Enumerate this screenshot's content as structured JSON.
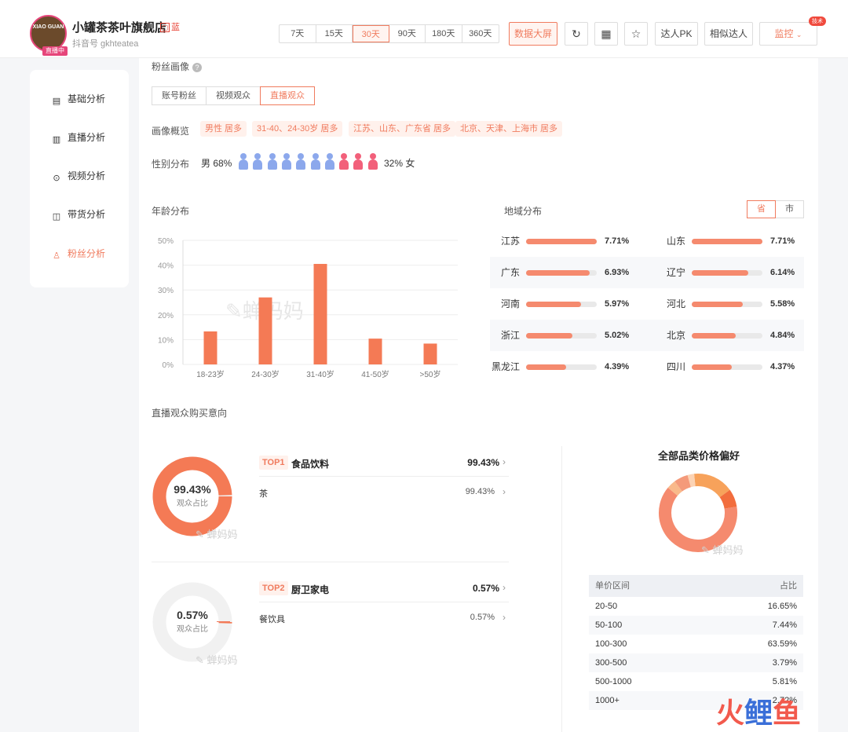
{
  "header": {
    "avatar_logo_text": "XIAO GUAN",
    "live_badge": "直播中",
    "shop_name": "小罐茶茶叶旗舰店",
    "shop_tag": "蓝",
    "shop_id": "抖音号 gkhteatea",
    "days": [
      "7天",
      "15天",
      "30天",
      "90天",
      "180天",
      "360天"
    ],
    "active_day": "30天",
    "big_screen": "数据大屏",
    "daren_pk": "达人PK",
    "similar": "相似达人",
    "monitor": "监控",
    "hot_badge": "技术"
  },
  "sidebar": {
    "items": [
      {
        "label": "基础分析",
        "icon": "bar-chart-icon"
      },
      {
        "label": "直播分析",
        "icon": "live-icon"
      },
      {
        "label": "视频分析",
        "icon": "play-icon"
      },
      {
        "label": "带货分析",
        "icon": "bag-icon"
      },
      {
        "label": "粉丝分析",
        "icon": "user-icon"
      }
    ],
    "active": "粉丝分析"
  },
  "fans": {
    "title": "粉丝画像",
    "tabs": [
      "账号粉丝",
      "视频观众",
      "直播观众"
    ],
    "active_tab": "直播观众",
    "overview_label": "画像概览",
    "chips": [
      "男性 居多",
      "31-40、24-30岁 居多",
      "江苏、山东、广东省 居多",
      "北京、天津、上海市 居多"
    ],
    "gender_label": "性别分布",
    "male_text": "男 68%",
    "female_text": "32% 女",
    "male_icons": 7,
    "female_icons": 3
  },
  "age": {
    "title": "年龄分布",
    "watermark": "蝉妈妈"
  },
  "chart_data": {
    "type": "bar",
    "categories": [
      "18-23岁",
      "24-30岁",
      "31-40岁",
      "41-50岁",
      ">50岁"
    ],
    "values": [
      13.3,
      27,
      40.5,
      10.4,
      8.4
    ],
    "ylim": [
      0,
      50
    ],
    "yticks": [
      "0%",
      "10%",
      "20%",
      "30%",
      "40%",
      "50%"
    ],
    "ylabel": "",
    "xlabel": "",
    "color": "#f47a55",
    "grid": true
  },
  "region": {
    "title": "地域分布",
    "toggle": [
      "省",
      "市"
    ],
    "active_toggle": "省",
    "rows": [
      [
        {
          "name": "江苏",
          "value": "7.71%",
          "pct": 7.71
        },
        {
          "name": "山东",
          "value": "7.71%",
          "pct": 7.71
        }
      ],
      [
        {
          "name": "广东",
          "value": "6.93%",
          "pct": 6.93
        },
        {
          "name": "辽宁",
          "value": "6.14%",
          "pct": 6.14
        }
      ],
      [
        {
          "name": "河南",
          "value": "5.97%",
          "pct": 5.97
        },
        {
          "name": "河北",
          "value": "5.58%",
          "pct": 5.58
        }
      ],
      [
        {
          "name": "浙江",
          "value": "5.02%",
          "pct": 5.02
        },
        {
          "name": "北京",
          "value": "4.84%",
          "pct": 4.84
        }
      ],
      [
        {
          "name": "黑龙江",
          "value": "4.39%",
          "pct": 4.39
        },
        {
          "name": "四川",
          "value": "4.37%",
          "pct": 4.37
        }
      ]
    ]
  },
  "purchase": {
    "title": "直播观众购买意向",
    "watermark": "蝉妈妈",
    "items": [
      {
        "rank": "TOP1",
        "category": "食品饮料",
        "value": "99.43%",
        "donut_pct": 99.43,
        "donut_label": "观众占比",
        "sub_name": "茶",
        "sub_value": "99.43%"
      },
      {
        "rank": "TOP2",
        "category": "厨卫家电",
        "value": "0.57%",
        "donut_pct": 0.57,
        "donut_label": "观众占比",
        "sub_name": "餐饮具",
        "sub_value": "0.57%"
      }
    ]
  },
  "price": {
    "title": "全部品类价格偏好",
    "col_range": "单价区间",
    "col_share": "占比",
    "rows": [
      {
        "range": "20-50",
        "share": "16.65%",
        "pct": 16.65,
        "color": "#f7a25b"
      },
      {
        "range": "50-100",
        "share": "7.44%",
        "pct": 7.44,
        "color": "#f26d3d"
      },
      {
        "range": "100-300",
        "share": "63.59%",
        "pct": 63.59,
        "color": "#f58a6e"
      },
      {
        "range": "300-500",
        "share": "3.79%",
        "pct": 3.79,
        "color": "#f9b98a"
      },
      {
        "range": "500-1000",
        "share": "5.81%",
        "pct": 5.81,
        "color": "#f49a7a"
      },
      {
        "range": "1000+",
        "share": "2.72%",
        "pct": 2.72,
        "color": "#fcd3b4"
      }
    ]
  },
  "brand": {
    "a": "火",
    "b": "鲤",
    "c": "鱼"
  }
}
